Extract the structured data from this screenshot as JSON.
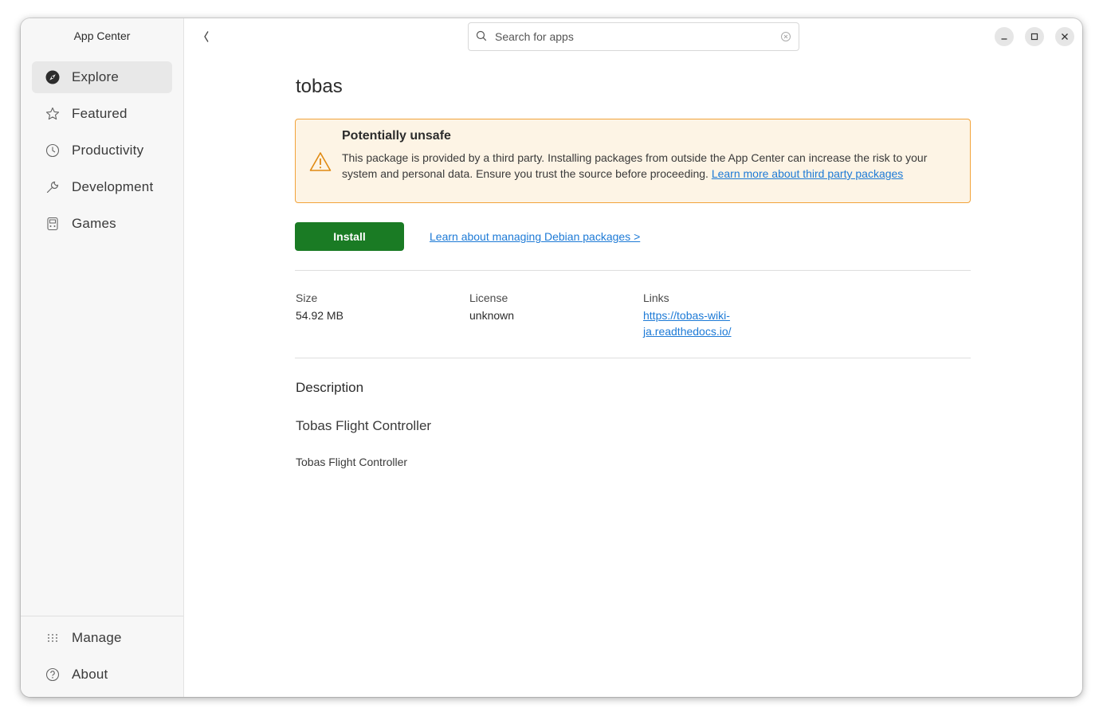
{
  "app": {
    "title": "App Center"
  },
  "sidebar": {
    "items": [
      {
        "label": "Explore",
        "icon": "compass-icon",
        "active": true
      },
      {
        "label": "Featured",
        "icon": "star-icon",
        "active": false
      },
      {
        "label": "Productivity",
        "icon": "clock-icon",
        "active": false
      },
      {
        "label": "Development",
        "icon": "wrench-icon",
        "active": false
      },
      {
        "label": "Games",
        "icon": "game-icon",
        "active": false
      }
    ],
    "bottom_items": [
      {
        "label": "Manage",
        "icon": "grid-dots-icon"
      },
      {
        "label": "About",
        "icon": "help-icon"
      }
    ]
  },
  "search": {
    "placeholder": "Search for apps",
    "value": ""
  },
  "package": {
    "name": "tobas",
    "warning": {
      "title": "Potentially unsafe",
      "body": "This package is provided by a third party. Installing packages from outside the App Center can increase the risk to your system and personal data. Ensure you trust the source before proceeding. ",
      "link_text": "Learn more about third party packages"
    },
    "install_label": "Install",
    "manage_link": "Learn about managing Debian packages >",
    "meta": {
      "size_label": "Size",
      "size_value": "54.92 MB",
      "license_label": "License",
      "license_value": "unknown",
      "links_label": "Links",
      "links_line1": "https://tobas-wiki-",
      "links_line2": "ja.readthedocs.io/"
    },
    "description": {
      "heading": "Description",
      "summary": "Tobas Flight Controller",
      "body": "Tobas Flight Controller"
    }
  },
  "colors": {
    "install": "#1a7b24",
    "warning_bg": "#fdf4e5",
    "warning_border": "#f2a33a",
    "link": "#1d7ad6"
  }
}
